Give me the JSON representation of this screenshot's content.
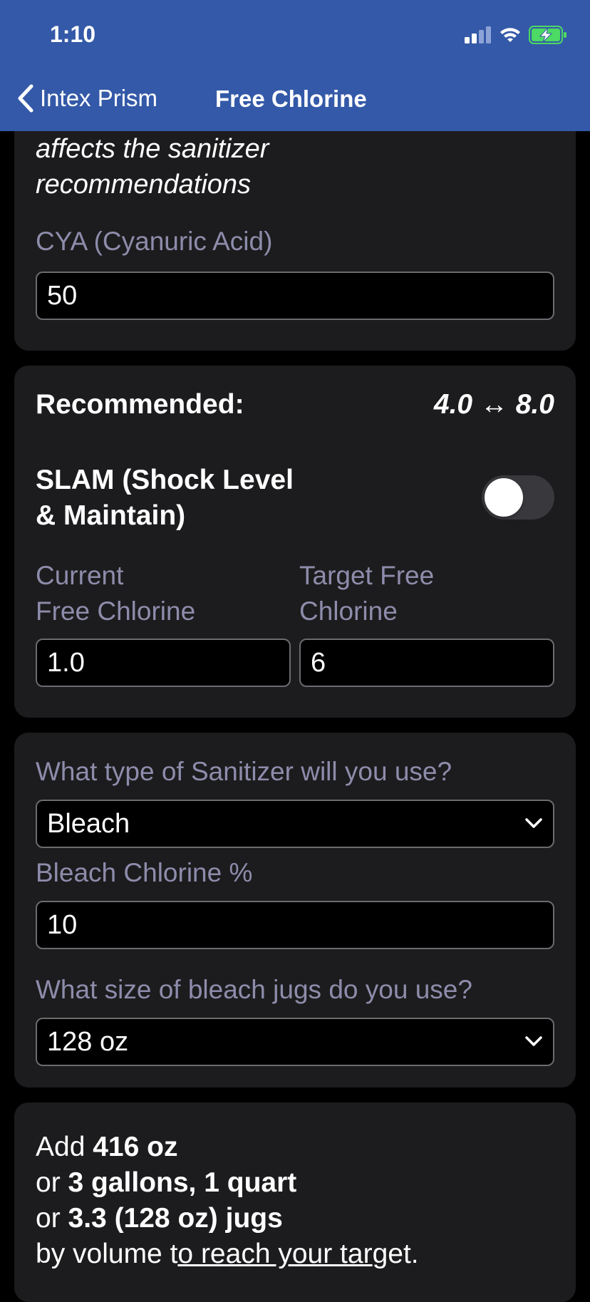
{
  "status": {
    "time": "1:10"
  },
  "nav": {
    "back_label": "Intex Prism",
    "title": "Free Chlorine"
  },
  "cya_card": {
    "intro_line1": "affects the sanitizer",
    "intro_line2": "recommendations",
    "cya_label": "CYA (Cyanuric Acid)",
    "cya_value": "50"
  },
  "chlorine_card": {
    "recommended_label": "Recommended:",
    "recommended_range": "4.0 ↔ 8.0",
    "slam_line1": "SLAM (Shock Level",
    "slam_line2": "& Maintain)",
    "slam_enabled": false,
    "current_label_line1": "Current",
    "current_label_line2": "Free Chlorine",
    "current_value": "1.0",
    "target_label_line1": "Target Free",
    "target_label_line2": "Chlorine",
    "target_value": "6"
  },
  "sanitizer_card": {
    "type_label": "What type of Sanitizer will you use?",
    "type_value": "Bleach",
    "strength_label": "Bleach Chlorine %",
    "strength_value": "10",
    "jug_label": "What size of bleach jugs do you use?",
    "jug_value": "128 oz"
  },
  "result": {
    "line1_prefix": "Add ",
    "line1_bold": "416 oz",
    "line2_prefix": "or ",
    "line2_bold": "3 gallons, 1 quart",
    "line3_prefix": "or ",
    "line3_bold": "3.3 (128 oz) jugs",
    "line4_prefix": "by volume t",
    "line4_link": "o reach your tar",
    "line4_suffix": "get."
  },
  "colors": {
    "header": "#3459a8",
    "card": "#1c1c1e",
    "label": "#8e8cab",
    "battery": "#4cd964"
  },
  "icons": [
    "signal-icon",
    "wifi-icon",
    "battery-charging-icon",
    "back-chevron-icon",
    "chevron-down-icon"
  ]
}
